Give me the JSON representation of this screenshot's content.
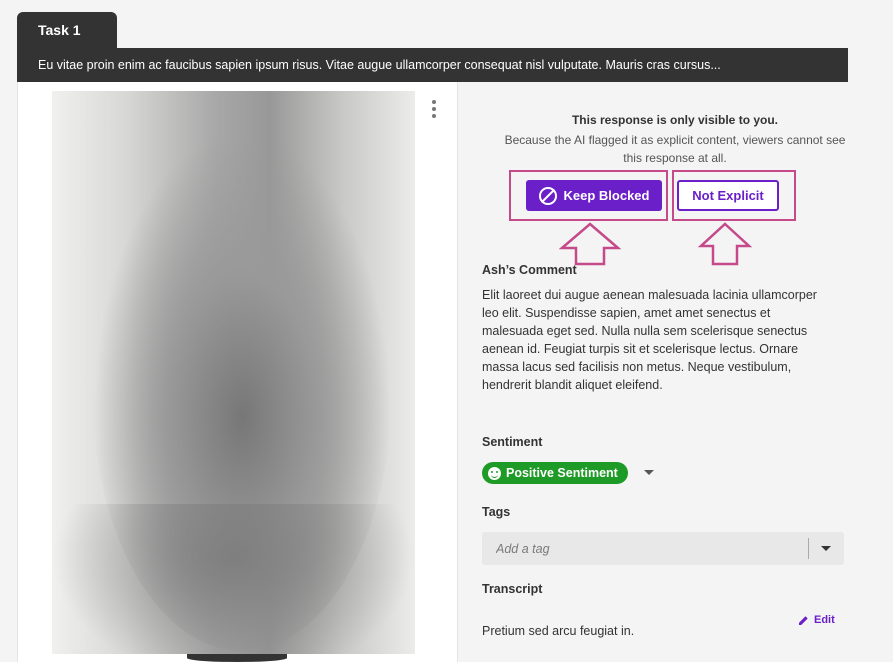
{
  "tab": {
    "label": "Task 1"
  },
  "banner": {
    "text": "Eu vitae proin enim ac faucibus sapien ipsum risus. Vitae augue ullamcorper consequat nisl vulputate. Mauris cras cursus..."
  },
  "media": {
    "menu_icon": "kebab-vertical-icon"
  },
  "notice": {
    "title": "This response is only visible to you.",
    "body": "Because the AI flagged it as explicit content, viewers cannot see this response at all."
  },
  "actions": {
    "keep_blocked": "Keep Blocked",
    "keep_blocked_icon": "ban-icon",
    "not_explicit": "Not Explicit"
  },
  "comment": {
    "heading": "Ash’s Comment",
    "text": "Elit laoreet dui augue aenean malesuada lacinia ullamcorper leo elit. Suspendisse sapien, amet amet senectus et malesuada eget sed. Nulla nulla sem scelerisque senectus aenean id. Feugiat turpis sit et scelerisque lectus. Ornare massa lacus sed facilisis non metus. Neque vestibulum, hendrerit blandit aliquet eleifend."
  },
  "sentiment": {
    "heading": "Sentiment",
    "value": "Positive Sentiment",
    "icon": "smiley-icon",
    "color": "#1e9a26"
  },
  "tags": {
    "heading": "Tags",
    "placeholder": "Add a tag"
  },
  "transcript": {
    "heading": "Transcript",
    "edit_label": "Edit",
    "text": "Pretium sed arcu feugiat in."
  },
  "colors": {
    "accent": "#6a1fc9",
    "highlight": "#c44a8a",
    "dark": "#333333"
  }
}
